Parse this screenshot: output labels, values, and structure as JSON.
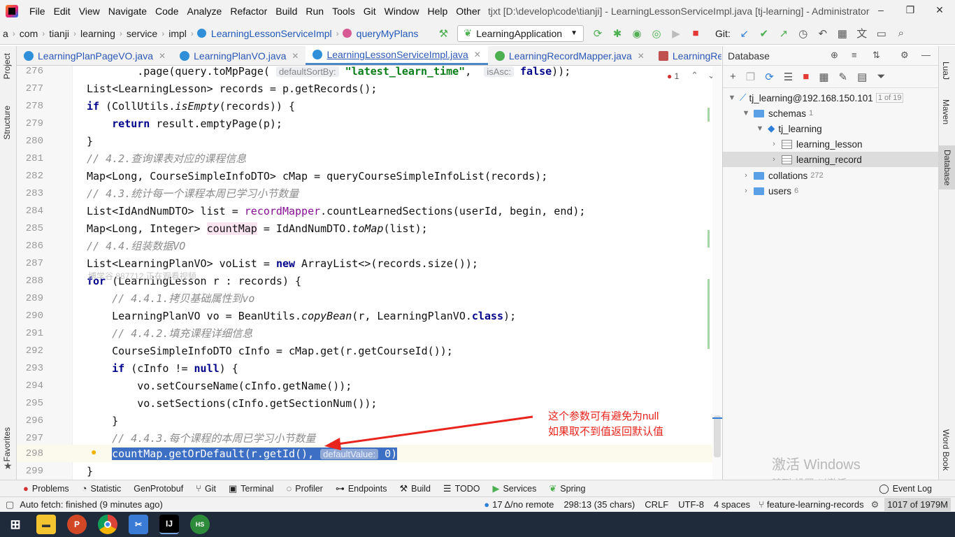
{
  "menubar": {
    "items": [
      "File",
      "Edit",
      "View",
      "Navigate",
      "Code",
      "Analyze",
      "Refactor",
      "Build",
      "Run",
      "Tools",
      "Git",
      "Window",
      "Help",
      "Other"
    ],
    "title": "tjxt [D:\\develop\\code\\tianji] - LearningLessonServiceImpl.java [tj-learning] - Administrator"
  },
  "breadcrumb": [
    "a",
    "com",
    "tianji",
    "learning",
    "service",
    "impl",
    "LearningLessonServiceImpl",
    "queryMyPlans"
  ],
  "run_config": "LearningApplication",
  "git_label": "Git:",
  "tabs": [
    {
      "label": "LearningPlanPageVO.java",
      "color": "#2f8fd8"
    },
    {
      "label": "LearningPlanVO.java",
      "color": "#2f8fd8"
    },
    {
      "label": "LearningLessonServiceImpl.java",
      "color": "#2f8fd8",
      "active": true
    },
    {
      "label": "LearningRecordMapper.java",
      "color": "#4caf50"
    },
    {
      "label": "LearningRecordMa",
      "color": "#c0504d"
    }
  ],
  "left_tools": [
    "Project",
    "Structure",
    "Favorites"
  ],
  "right_tools": [
    "LuaJ",
    "Maven",
    "Database",
    "Word Book"
  ],
  "editor": {
    "problems_count": "1",
    "lines": [
      {
        "n": "276"
      },
      {
        "n": "277"
      },
      {
        "n": "278"
      },
      {
        "n": "279"
      },
      {
        "n": "280"
      },
      {
        "n": "281"
      },
      {
        "n": "282"
      },
      {
        "n": "283"
      },
      {
        "n": "284"
      },
      {
        "n": "285"
      },
      {
        "n": "286"
      },
      {
        "n": "287"
      },
      {
        "n": "288"
      },
      {
        "n": "289"
      },
      {
        "n": "290"
      },
      {
        "n": "291"
      },
      {
        "n": "292"
      },
      {
        "n": "293"
      },
      {
        "n": "294"
      },
      {
        "n": "295"
      },
      {
        "n": "296"
      },
      {
        "n": "297"
      },
      {
        "n": "298"
      },
      {
        "n": "299"
      }
    ],
    "watermark_text": "博学谷 887712 正在观看视频"
  },
  "database": {
    "title": "Database",
    "connection": "tj_learning@192.168.150.101",
    "connection_badge": "1 of 19",
    "schemas_label": "schemas",
    "schemas_count": "1",
    "schema": "tj_learning",
    "tables": [
      "learning_lesson",
      "learning_record"
    ],
    "collations_label": "collations",
    "collations_count": "272",
    "users_label": "users",
    "users_count": "6"
  },
  "annotation": {
    "line1": "这个参数可有避免为null",
    "line2": "如果取不到值返回默认值"
  },
  "activation": {
    "title": "激活 Windows",
    "subtitle": "转到“设置”以激活 Windows。"
  },
  "toolwindows": [
    "Problems",
    "Statistic",
    "GenProtobuf",
    "Git",
    "Terminal",
    "Profiler",
    "Endpoints",
    "Build",
    "TODO",
    "Services",
    "Spring",
    "Event Log"
  ],
  "status": {
    "message": "Auto fetch: finished (9 minutes ago)",
    "vcs": "17 Δ/no remote",
    "position": "298:13 (35 chars)",
    "line_sep": "CRLF",
    "encoding": "UTF-8",
    "indent": "4 spaces",
    "branch": "feature-learning-records",
    "memory": "1017 of 1979M"
  },
  "taskbar": {
    "apps": [
      "start-icon",
      "file-explorer-icon",
      "powerpoint-icon",
      "chrome-icon",
      "screenshot-tool-icon",
      "intellij-icon",
      "hs-icon"
    ]
  }
}
